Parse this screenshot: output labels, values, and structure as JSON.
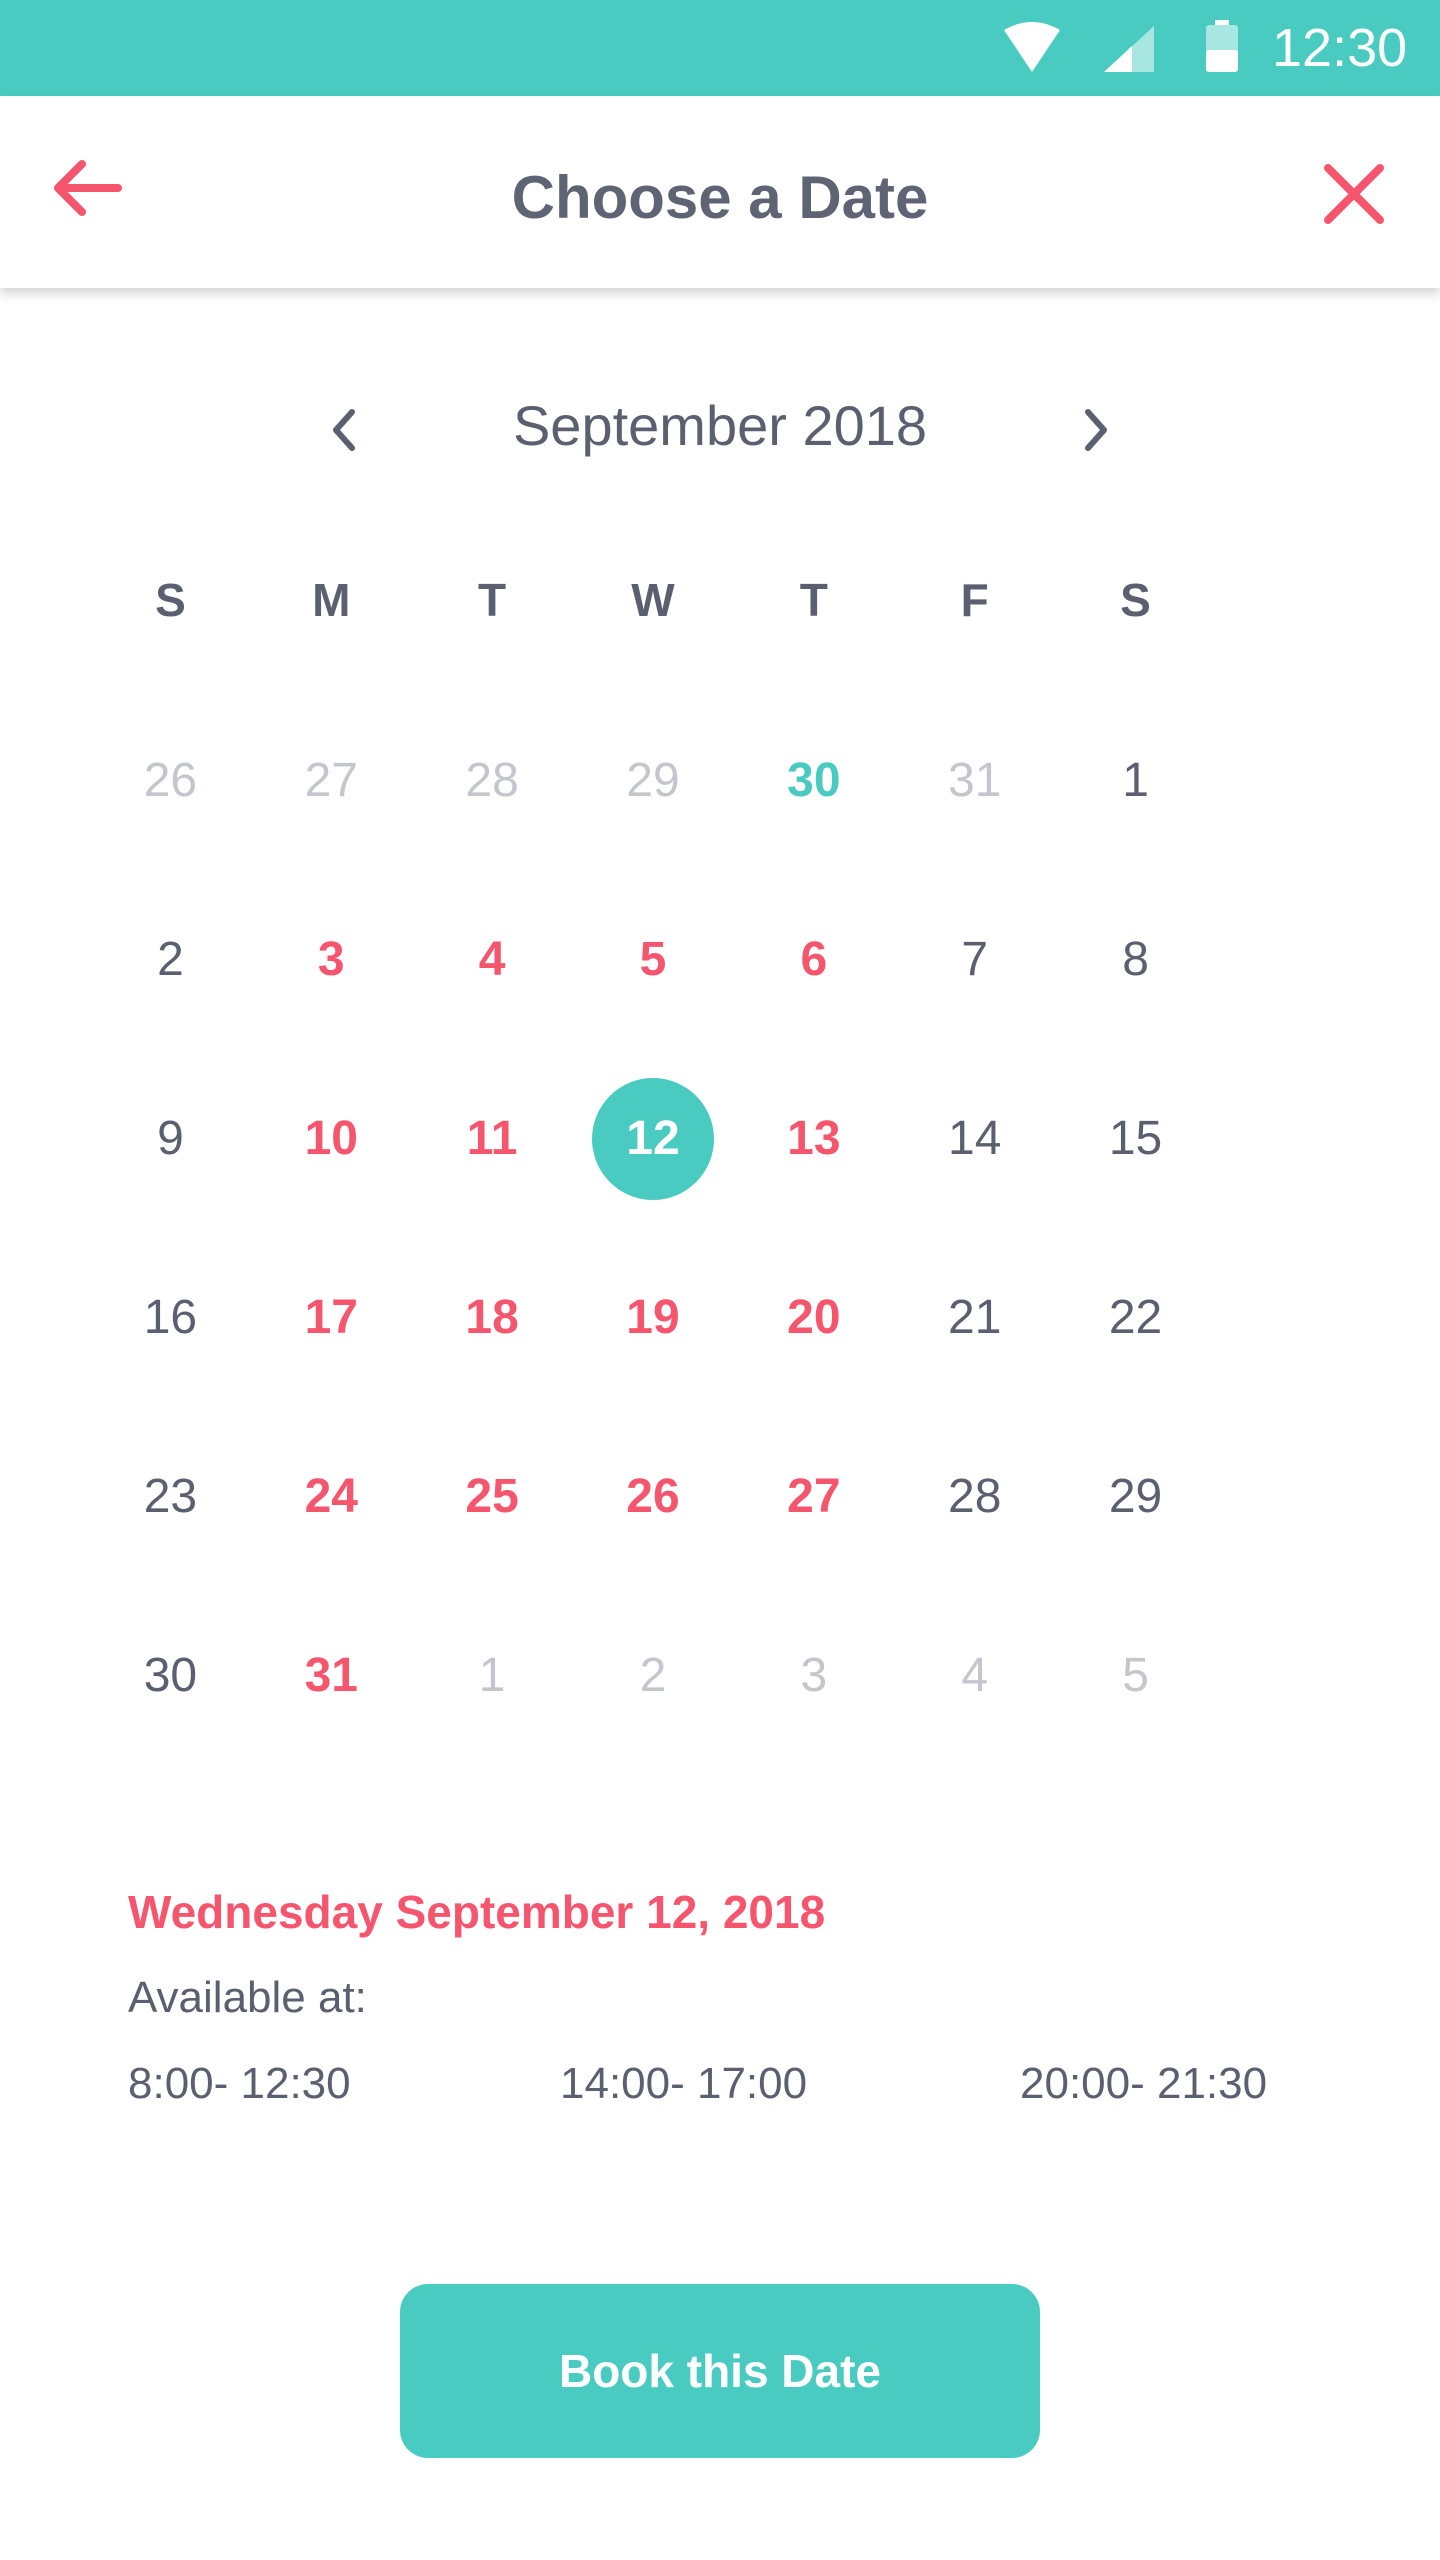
{
  "status_bar": {
    "time": "12:30",
    "background": "#49cbc1",
    "icons": [
      "wifi-icon",
      "signal-icon",
      "battery-icon"
    ]
  },
  "header": {
    "title": "Choose a Date",
    "back_icon": "arrow-left-icon",
    "close_icon": "close-icon",
    "accent": "#f5566e"
  },
  "calendar": {
    "month_label": "September 2018",
    "prev_icon": "chevron-left-icon",
    "next_icon": "chevron-right-icon",
    "weekdays": [
      "S",
      "M",
      "T",
      "W",
      "T",
      "F",
      "S"
    ],
    "days": [
      {
        "label": "26",
        "state": "other"
      },
      {
        "label": "27",
        "state": "other"
      },
      {
        "label": "28",
        "state": "other"
      },
      {
        "label": "29",
        "state": "other"
      },
      {
        "label": "30",
        "state": "today"
      },
      {
        "label": "31",
        "state": "other"
      },
      {
        "label": "1",
        "state": "normal"
      },
      {
        "label": "2",
        "state": "normal"
      },
      {
        "label": "3",
        "state": "avail"
      },
      {
        "label": "4",
        "state": "avail"
      },
      {
        "label": "5",
        "state": "avail"
      },
      {
        "label": "6",
        "state": "avail"
      },
      {
        "label": "7",
        "state": "normal"
      },
      {
        "label": "8",
        "state": "normal"
      },
      {
        "label": "9",
        "state": "normal"
      },
      {
        "label": "10",
        "state": "avail"
      },
      {
        "label": "11",
        "state": "avail"
      },
      {
        "label": "12",
        "state": "selected"
      },
      {
        "label": "13",
        "state": "avail"
      },
      {
        "label": "14",
        "state": "normal"
      },
      {
        "label": "15",
        "state": "normal"
      },
      {
        "label": "16",
        "state": "normal"
      },
      {
        "label": "17",
        "state": "avail"
      },
      {
        "label": "18",
        "state": "avail"
      },
      {
        "label": "19",
        "state": "avail"
      },
      {
        "label": "20",
        "state": "avail"
      },
      {
        "label": "21",
        "state": "normal"
      },
      {
        "label": "22",
        "state": "normal"
      },
      {
        "label": "23",
        "state": "normal"
      },
      {
        "label": "24",
        "state": "avail"
      },
      {
        "label": "25",
        "state": "avail"
      },
      {
        "label": "26",
        "state": "avail"
      },
      {
        "label": "27",
        "state": "avail"
      },
      {
        "label": "28",
        "state": "normal"
      },
      {
        "label": "29",
        "state": "normal"
      },
      {
        "label": "30",
        "state": "normal"
      },
      {
        "label": "31",
        "state": "avail"
      },
      {
        "label": "1",
        "state": "other"
      },
      {
        "label": "2",
        "state": "other"
      },
      {
        "label": "3",
        "state": "other"
      },
      {
        "label": "4",
        "state": "other"
      },
      {
        "label": "5",
        "state": "other"
      }
    ],
    "colors": {
      "selected": "#49cbc1",
      "available": "#f5566e",
      "muted": "#c3c6cc",
      "text": "#5b6070"
    }
  },
  "selection": {
    "date_label": "Wednesday September 12, 2018",
    "available_label": "Available at:",
    "slots": [
      "8:00- 12:30",
      "14:00- 17:00",
      "20:00- 21:30"
    ]
  },
  "action": {
    "book_label": "Book this Date"
  }
}
